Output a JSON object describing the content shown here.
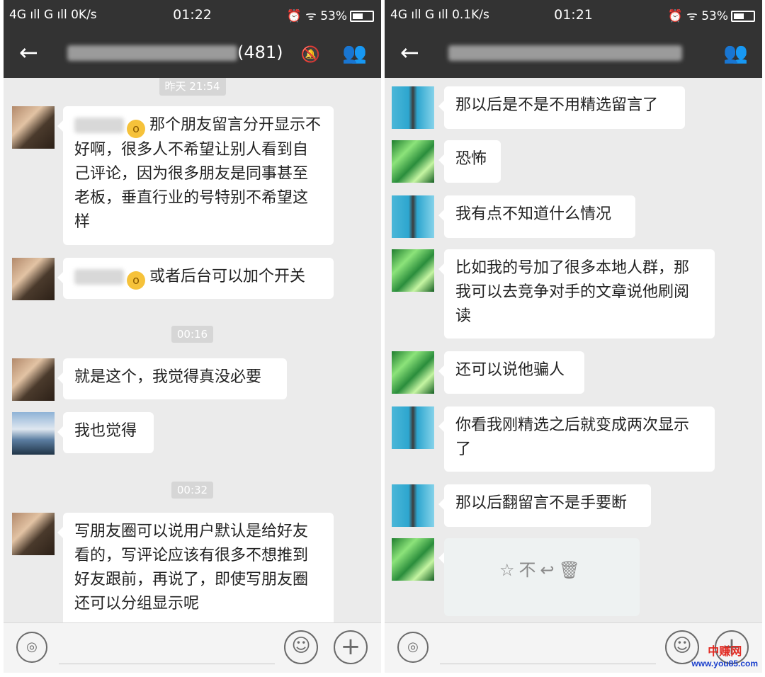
{
  "left": {
    "status": {
      "network": "4G ıll G ıll 0K/s",
      "time": "01:22",
      "battery": "53%"
    },
    "header": {
      "title_count": "(481)"
    },
    "timestamps": [
      "昨天 21:54",
      "00:16",
      "00:32"
    ],
    "messages": [
      "那个朋友留言分开显示不好啊，很多人不希望让别人看到自己评论，因为很多朋友是同事甚至老板，垂直行业的号特别不希望这样",
      "或者后台可以加个开关",
      "就是这个，我觉得真没必要",
      "我也觉得",
      "写朋友圈可以说用户默认是给好友看的，写评论应该有很多不想推到好友跟前，再说了，即使写朋友圈还可以分组显示呢"
    ]
  },
  "right": {
    "status": {
      "network": "4G ıll G ıll 0.1K/s",
      "time": "01:21",
      "battery": "53%"
    },
    "messages": [
      "那以后是不是不用精选留言了",
      "恐怖",
      "我有点不知道什么情况",
      "比如我的号加了很多本地人群，那我可以去竞争对手的文章说他刷阅读",
      "还可以说他骗人",
      "你看我刚精选之后就变成两次显示了",
      "那以后翻留言不是手要断"
    ]
  },
  "icons": {
    "back": "←",
    "mute": "🔕",
    "members": "👥",
    "voice": "◎",
    "emoji": "☺",
    "plus": "+",
    "quote_actions": "☆不↩🗑"
  },
  "watermark": {
    "main": "中赚网",
    "url": "www.you85.com"
  }
}
